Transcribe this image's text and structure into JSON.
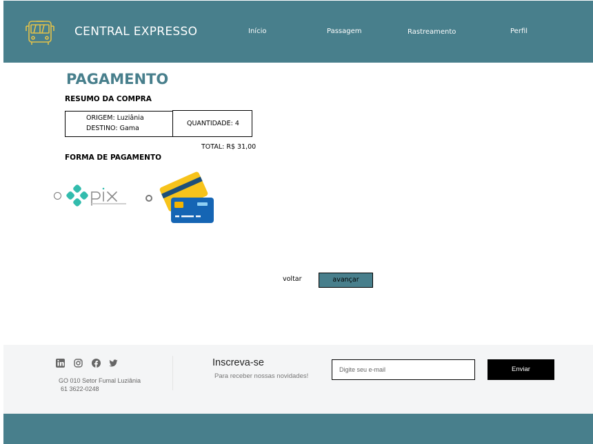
{
  "header": {
    "brand": "CENTRAL EXPRESSO",
    "nav": [
      "Início",
      "Passagem",
      "Rastreamento",
      "Perfil"
    ]
  },
  "main": {
    "title": "PAGAMENTO",
    "summary_title": "RESUMO DA COMPRA",
    "origin": "ORIGEM: Luziânia",
    "destination": "DESTINO: Gama",
    "quantity": "QUANTIDADE: 4",
    "total": "TOTAL: R$ 31,00",
    "payment_title": "FORMA DE PAGAMENTO",
    "payment_options": [
      {
        "name": "pix",
        "selected": false
      },
      {
        "name": "card",
        "selected": true
      }
    ],
    "back_label": "voltar",
    "next_label": "avançar"
  },
  "footer": {
    "social_icons": [
      "linkedin-icon",
      "instagram-icon",
      "facebook-icon",
      "twitter-icon"
    ],
    "address_line1": "GO 010 Setor Fumal Luziânia",
    "address_line2": "61 3622-0248",
    "subscribe_title": "Inscreva-se",
    "subscribe_text": "Para receber nossas novidades!",
    "email_placeholder": "Digite seu e-mail",
    "send_label": "Enviar"
  },
  "colors": {
    "primary": "#487f8c",
    "footer_bg": "#f4f5f6",
    "logo_yellow": "#e3c24a"
  }
}
